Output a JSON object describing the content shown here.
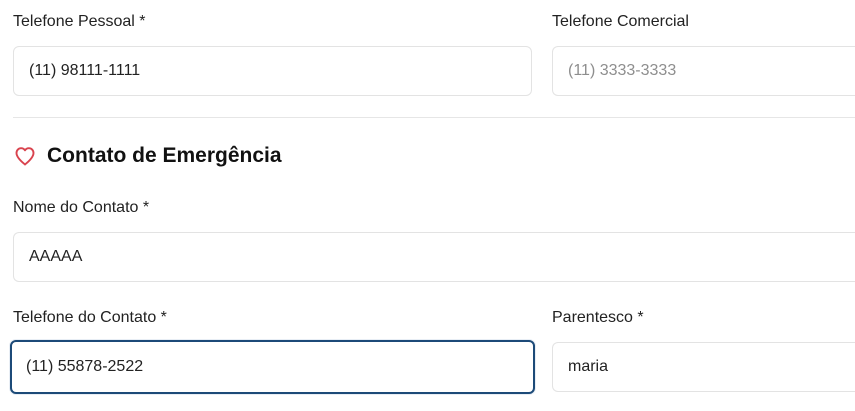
{
  "personal_contact": {
    "personal_phone": {
      "label": "Telefone Pessoal *",
      "value": "(11) 98111-1111"
    },
    "business_phone": {
      "label": "Telefone Comercial",
      "placeholder": "(11) 3333-3333"
    }
  },
  "emergency_section": {
    "title": "Contato de Emergência",
    "icon": "heart-icon",
    "icon_color": "#d9434e",
    "contact_name": {
      "label": "Nome do Contato *",
      "value": "AAAAA"
    },
    "contact_phone": {
      "label": "Telefone do Contato *",
      "value": "(11) 55878-2522"
    },
    "relationship": {
      "label": "Parentesco *",
      "value": "maria"
    }
  },
  "colors": {
    "focus_border": "#1c4a78",
    "field_border": "#e3e3e3"
  }
}
